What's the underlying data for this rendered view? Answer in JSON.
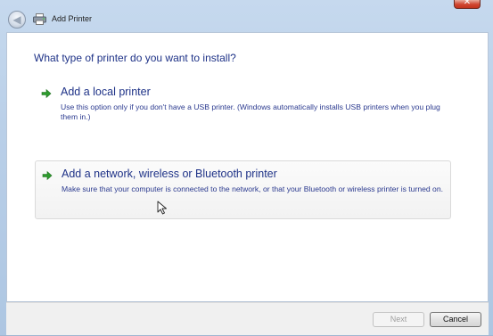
{
  "window": {
    "title": "Add Printer",
    "close_glyph": "✕"
  },
  "icons": {
    "back": "back-arrow-icon",
    "printer": "printer-icon",
    "option_arrow": "green-arrow-icon",
    "cursor": "mouse-cursor-icon"
  },
  "main": {
    "question": "What type of printer do you want to install?",
    "options": [
      {
        "title": "Add a local printer",
        "description": "Use this option only if you don't have a USB printer. (Windows automatically installs USB printers when you plug them in.)"
      },
      {
        "title": "Add a network, wireless or Bluetooth printer",
        "description": "Make sure that your computer is connected to the network, or that your Bluetooth or wireless printer is turned on."
      }
    ]
  },
  "footer": {
    "next_label": "Next",
    "cancel_label": "Cancel"
  },
  "colors": {
    "link_blue": "#1e3287",
    "arrow_green": "#2e9c2e"
  }
}
